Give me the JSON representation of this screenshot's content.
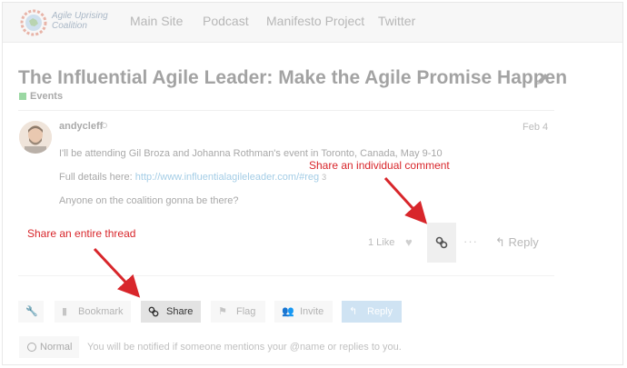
{
  "header": {
    "logo_text_line1": "Agile Uprising",
    "logo_text_line2": "Coalition",
    "nav": [
      "Main Site",
      "Podcast",
      "Manifesto Project",
      "Twitter"
    ]
  },
  "topic": {
    "title": "The Influential Agile Leader: Make the Agile Promise Happen",
    "category": "Events",
    "category_color": "#9bd8a3"
  },
  "post": {
    "username": "andycleff",
    "date": "Feb 4",
    "line1": "I'll be attending Gil Broza and Johanna Rothman's event in Toronto, Canada, May 9-10",
    "details_prefix": "Full details here: ",
    "details_link": "http://www.influentialagileleader.com/#reg",
    "link_clicks": "3",
    "line3": "Anyone on the coalition gonna be there?",
    "likes": "1 Like",
    "reply": "Reply"
  },
  "footer": {
    "buttons": [
      "Bookmark",
      "Share",
      "Flag",
      "Invite",
      "Reply"
    ],
    "notification_level": "Normal",
    "notification_text": "You will be notified if someone mentions your @name or replies to you."
  },
  "annotations": {
    "comment": "Share an individual comment",
    "thread": "Share an entire thread",
    "color": "#d8262b"
  }
}
